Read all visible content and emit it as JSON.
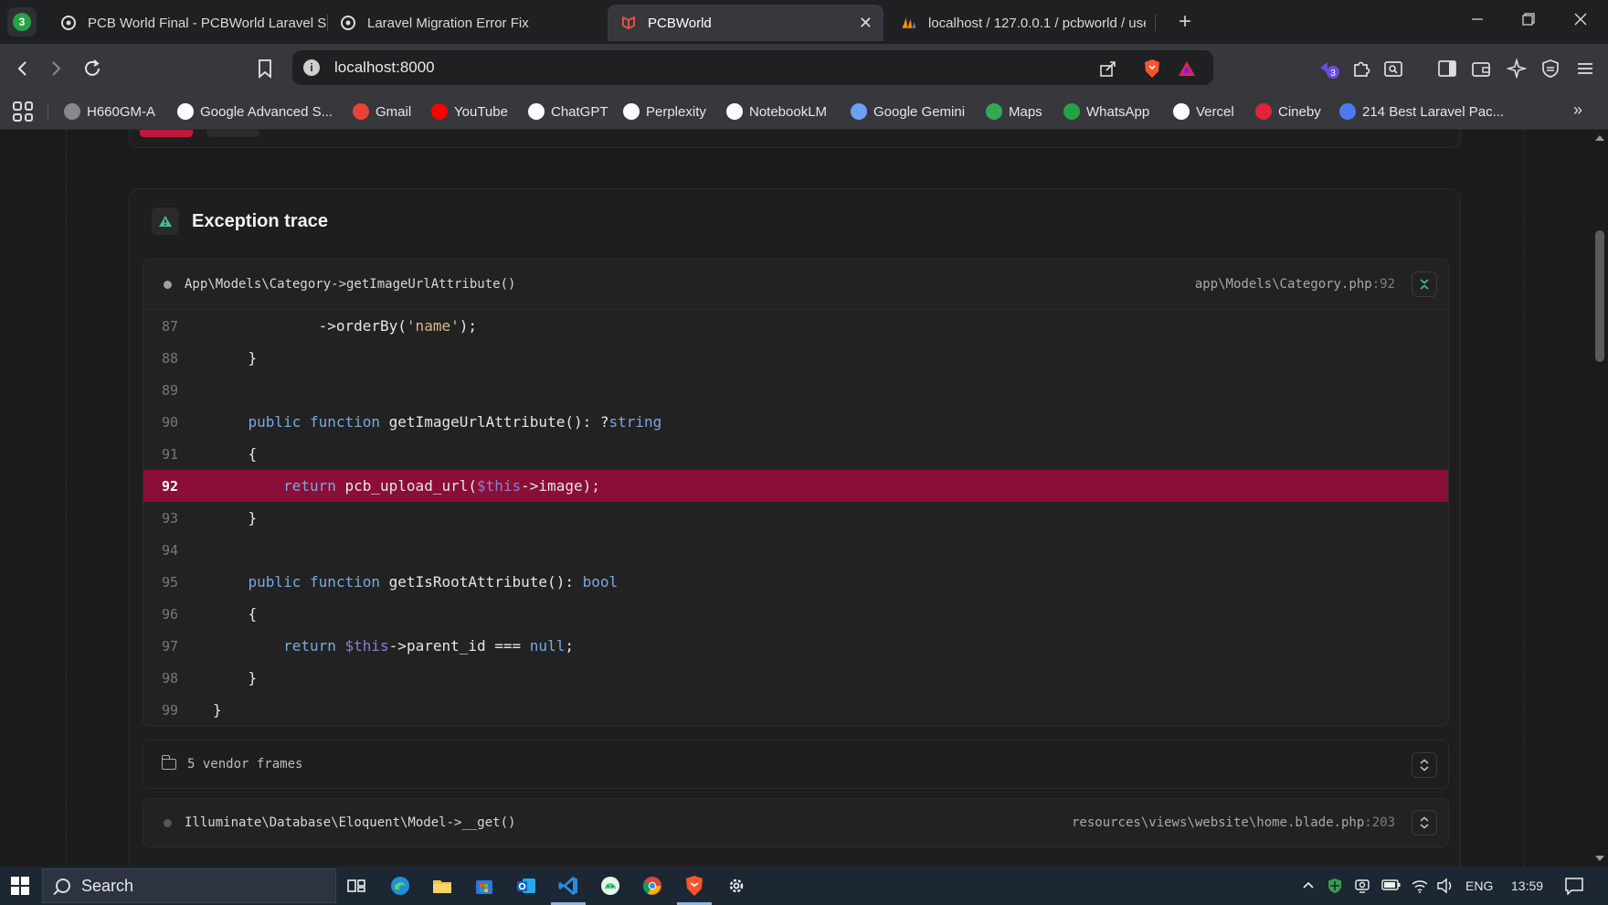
{
  "browser": {
    "profile_badge": "3",
    "tabs": [
      {
        "title": "PCB World Final - PCBWorld Laravel S",
        "icon": "openai-icon"
      },
      {
        "title": "Laravel Migration Error Fix",
        "icon": "openai-icon"
      },
      {
        "title": "PCBWorld",
        "icon": "laravel-icon",
        "active": true
      },
      {
        "title": "localhost / 127.0.0.1 / pcbworld / use",
        "icon": "phpmyadmin-icon"
      }
    ],
    "tab_close": "✕",
    "new_tab": "+",
    "url": "localhost:8000",
    "extensions_badge": "3",
    "bookmarks": [
      {
        "label": "H660GM-A",
        "icon": "globe-icon",
        "color": "#888888"
      },
      {
        "label": "Google Advanced S...",
        "icon": "google-icon",
        "color": "#ffffff"
      },
      {
        "label": "Gmail",
        "icon": "gmail-icon",
        "color": "#ea4335"
      },
      {
        "label": "YouTube",
        "icon": "youtube-icon",
        "color": "#ff0000"
      },
      {
        "label": "ChatGPT",
        "icon": "openai-icon",
        "color": "#ffffff"
      },
      {
        "label": "Perplexity",
        "icon": "perplexity-icon",
        "color": "#ffffff"
      },
      {
        "label": "NotebookLM",
        "icon": "notebooklm-icon",
        "color": "#ffffff"
      },
      {
        "label": "Google Gemini",
        "icon": "gemini-icon",
        "color": "#6aa0f5"
      },
      {
        "label": "Maps",
        "icon": "maps-icon",
        "color": "#34a853"
      },
      {
        "label": "WhatsApp",
        "icon": "whatsapp-icon",
        "color": "#25a244"
      },
      {
        "label": "Vercel",
        "icon": "vercel-icon",
        "color": "#ffffff"
      },
      {
        "label": "Cineby",
        "icon": "cineby-icon",
        "color": "#e0243a"
      },
      {
        "label": "214 Best Laravel Pac...",
        "icon": "laravel-news-icon",
        "color": "#4a7cf0"
      }
    ]
  },
  "trace": {
    "title": "Exception trace",
    "frames": [
      {
        "call": "App\\Models\\Category->getImageUrlAttribute()",
        "file": "app\\Models\\Category.php",
        "line": ":92",
        "expanded": true,
        "code": [
          {
            "n": "87",
            "html": "            ->orderBy(<span class=\"str\">'name'</span>);"
          },
          {
            "n": "88",
            "html": "    }"
          },
          {
            "n": "89",
            "html": ""
          },
          {
            "n": "90",
            "html": "    <span class=\"kw\">public function</span> getImageUrlAttribute(): ?<span class=\"type\">string</span>"
          },
          {
            "n": "91",
            "html": "    {"
          },
          {
            "n": "92",
            "html": "        <span class=\"kw\">return</span> pcb_upload_url(<span class=\"var\">$this</span>->image);",
            "highlight": true
          },
          {
            "n": "93",
            "html": "    }"
          },
          {
            "n": "94",
            "html": ""
          },
          {
            "n": "95",
            "html": "    <span class=\"kw\">public function</span> getIsRootAttribute(): <span class=\"type\">bool</span>"
          },
          {
            "n": "96",
            "html": "    {"
          },
          {
            "n": "97",
            "html": "        <span class=\"kw\">return</span> <span class=\"var\">$this</span>->parent_id === <span class=\"kw\">null</span>;"
          },
          {
            "n": "98",
            "html": "    }"
          },
          {
            "n": "99",
            "html": "}"
          }
        ]
      }
    ],
    "vendor_frames": "5 vendor frames",
    "next_frame": {
      "call": "Illuminate\\Database\\Eloquent\\Model->__get()",
      "file": "resources\\views\\website\\home.blade.php",
      "line": ":203"
    }
  },
  "taskbar": {
    "search_placeholder": "Search",
    "tray_lang": "ENG",
    "tray_time": "13:59"
  },
  "colors": {
    "highlight_line": "#8a0e35",
    "accent_green": "#3fbf8a"
  }
}
